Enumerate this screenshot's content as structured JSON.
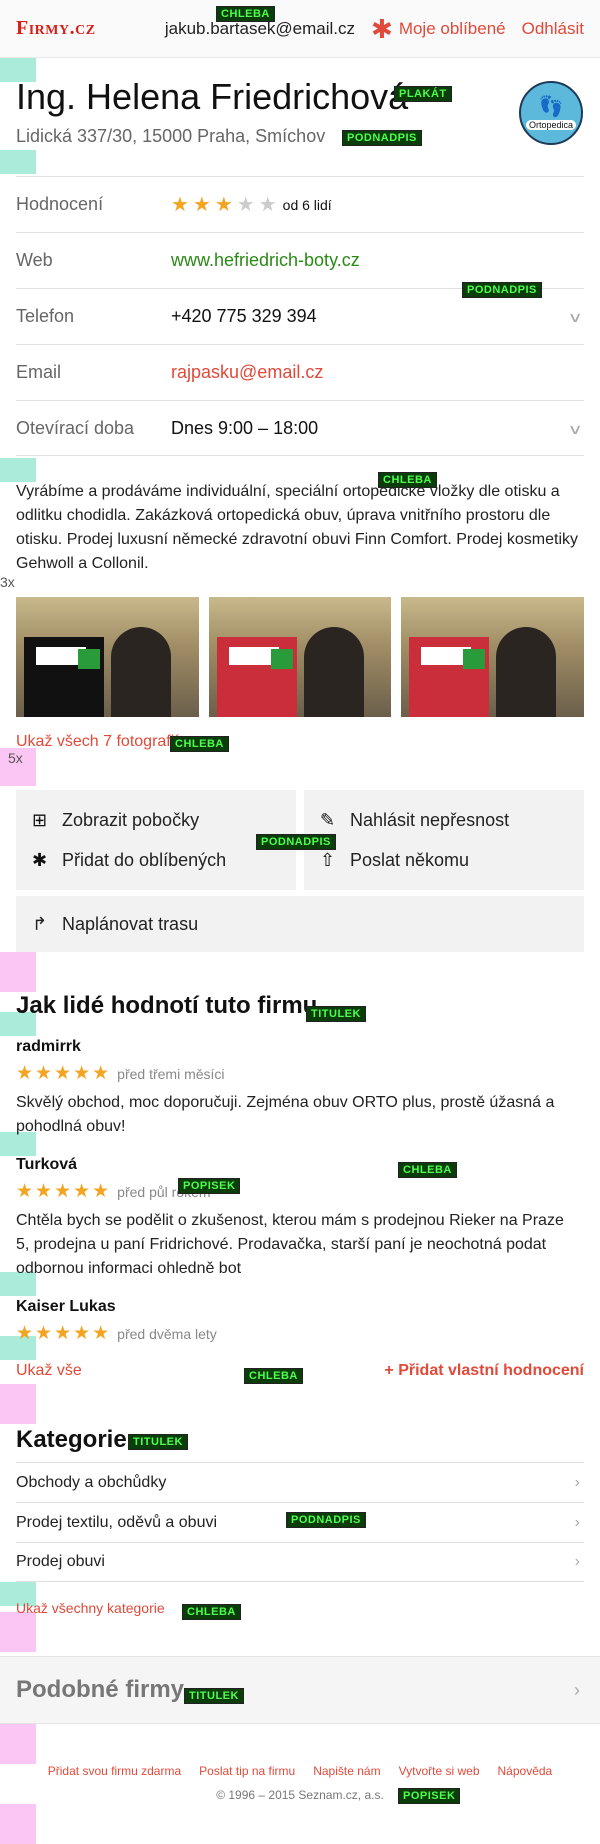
{
  "header": {
    "logo": "Firmy.cz",
    "email": "jakub.bartasek@email.cz",
    "favorites": "Moje oblíbené",
    "logout": "Odhlásit"
  },
  "tags": {
    "chleba": "CHLEBA",
    "plakat": "PLAKÁT",
    "podnadpis": "PODNADPIS",
    "titulek": "TITULEK",
    "popisek": "POPISEK"
  },
  "spacer_labels": {
    "x3": "3x",
    "x5": "5x"
  },
  "company": {
    "name": "Ing. Helena Friedrichová",
    "address": "Lidická 337/30, 15000 Praha, Smíchov",
    "badge_label": "Ortopedica"
  },
  "info": {
    "rating_label": "Hodnocení",
    "rating_value": 3,
    "rating_max": 5,
    "rating_count": "od 6 lidí",
    "web_label": "Web",
    "web_value": "www.hefriedrich-boty.cz",
    "phone_label": "Telefon",
    "phone_value": "+420 775 329 394",
    "email_label": "Email",
    "email_value": "rajpasku@email.cz",
    "hours_label": "Otevírací doba",
    "hours_value": "Dnes 9:00 – 18:00"
  },
  "description": "Vyrábíme a prodáváme individuální, speciální ortopedické vložky dle otisku a odlitku chodidla. Zakázková ortopedická obuv, úprava vnitřního prostoru dle otisku. Prodej luxusní německé zdravotní obuvi Finn Comfort. Prodej kosmetiky Gehwoll a Collonil.",
  "photos": {
    "show_all": "Ukaž všech 7 fotografií"
  },
  "actions": {
    "branches": "Zobrazit pobočky",
    "add_fav": "Přidat do oblíbených",
    "report": "Nahlásit nepřesnost",
    "send": "Poslat někomu",
    "route": "Naplánovat trasu"
  },
  "reviews": {
    "heading": "Jak lidé hodnotí tuto firmu",
    "items": [
      {
        "name": "radmirrk",
        "stars": 5,
        "when": "před třemi měsíci",
        "text": "Skvělý obchod, moc doporučuji. Zejména obuv ORTO plus, prostě úžasná a pohodlná obuv!"
      },
      {
        "name": "Turková",
        "stars": 5,
        "when": "před půl rokem",
        "text": "Chtěla bych se podělit o zkušenost, kterou mám s prodejnou Rieker na Praze 5, prodejna u paní Fridrichové. Prodavačka, starší paní je neochotná podat odbornou informaci ohledně bot"
      },
      {
        "name": "Kaiser Lukas",
        "stars": 5,
        "when": "před dvěma lety",
        "text": ""
      }
    ],
    "show_all": "Ukaž vše",
    "add": "+ Přidat vlastní hodnocení"
  },
  "categories": {
    "heading": "Kategorie",
    "items": [
      "Obchody a obchůdky",
      "Prodej textilu, oděvů a obuvi",
      "Prodej obuvi"
    ],
    "show_all": "Ukaž všechny kategorie"
  },
  "similar": {
    "heading": "Podobné firmy"
  },
  "footer": {
    "links": [
      "Přidat svou firmu zdarma",
      "Poslat tip na firmu",
      "Napište nám",
      "Vytvořte si web",
      "Nápověda"
    ],
    "copyright": "© 1996 – 2015 Seznam.cz, a.s."
  },
  "colors": {
    "accent": "#e04a3a",
    "link_green": "#2a8a16",
    "star": "#f4a423",
    "mint": "#a8ecd9",
    "pink": "#fbc6f3"
  }
}
